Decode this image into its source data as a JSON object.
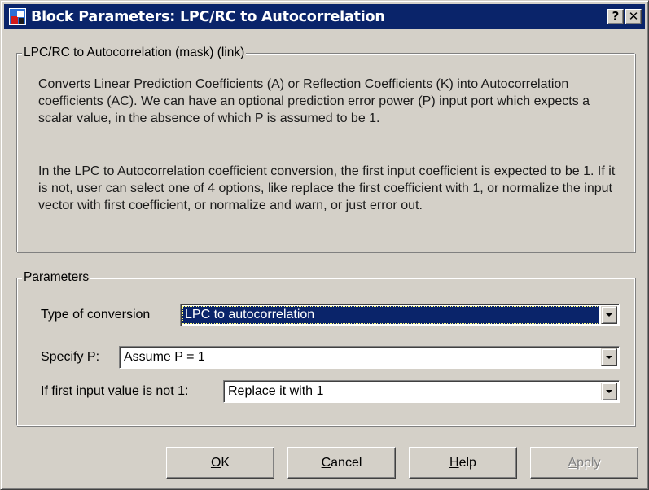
{
  "window": {
    "title": "Block Parameters: LPC/RC to Autocorrelation",
    "help_button": "?",
    "close_button": "✕"
  },
  "description_group": {
    "legend": "LPC/RC to Autocorrelation (mask) (link)",
    "paragraph1": "Converts Linear Prediction Coefficients (A) or Reflection Coefficients (K) into Autocorrelation coefficients (AC). We can have an optional prediction error power (P) input port which expects a scalar value, in the absence of which P is assumed to be 1.",
    "paragraph2": "In the LPC to Autocorrelation coefficient conversion, the first input coefficient is expected to be 1. If it is not, user can select one of 4 options, like replace the first coefficient with 1, or normalize the input vector with first coefficient, or normalize and warn, or just error out."
  },
  "parameters_group": {
    "legend": "Parameters",
    "type_of_conversion": {
      "label": "Type of conversion",
      "value": "LPC to autocorrelation"
    },
    "specify_p": {
      "label": "Specify P:",
      "value": "Assume P = 1"
    },
    "first_input": {
      "label": "If first input value is not 1:",
      "value": "Replace it with 1"
    }
  },
  "buttons": {
    "ok": {
      "mnemonic": "O",
      "rest": "K"
    },
    "cancel": {
      "mnemonic": "C",
      "rest": "ancel"
    },
    "help": {
      "mnemonic": "H",
      "rest": "elp"
    },
    "apply": {
      "mnemonic": "A",
      "rest": "pply",
      "enabled": false
    }
  },
  "colors": {
    "titlebar": "#0a246a",
    "dialog_face": "#d4d0c8",
    "selection": "#0a246a"
  },
  "icons": [
    "block-parameters-app-icon",
    "help-icon",
    "close-icon",
    "dropdown-arrow-icon"
  ]
}
